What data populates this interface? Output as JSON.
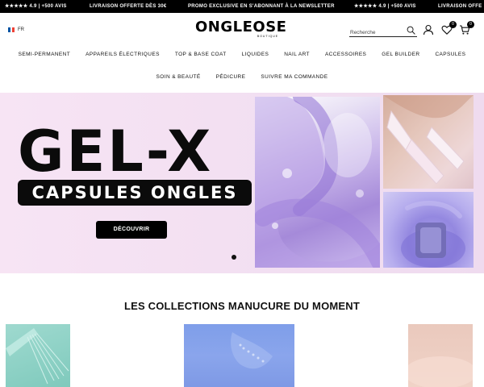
{
  "announcements": [
    "★★★★★ 4.9 | +500 AVIS",
    "LIVRAISON OFFERTE DÈS 30€",
    "PROMO EXCLUSIVE EN S'ABONNANT À LA NEWSLETTER",
    "★★★★★ 4.9 | +500 AVIS",
    "LIVRAISON OFFE"
  ],
  "header": {
    "language_code": "FR",
    "flag_colors": [
      "#0055a4",
      "#ffffff",
      "#ef4135"
    ],
    "logo_main": "ONGLEOSE",
    "logo_sub": "BOUTIQUE",
    "search_placeholder": "Recherche",
    "icons": [
      "search-icon",
      "account-icon",
      "wishlist-icon",
      "cart-icon"
    ],
    "wishlist_count": "0",
    "cart_count": "0"
  },
  "nav": {
    "row1": [
      "SEMI-PERMANENT",
      "APPAREILS ÉLECTRIQUES",
      "TOP & BASE COAT",
      "LIQUIDES",
      "NAIL ART",
      "ACCESSOIRES",
      "GEL BUILDER",
      "CAPSULES"
    ],
    "row2": [
      "SOIN & BEAUTÉ",
      "PÉDICURE",
      "SUIVRE MA COMMANDE"
    ]
  },
  "hero": {
    "title": "GEL-X",
    "subtitle": "CAPSULES ONGLES",
    "button_label": "DÉCOUVRIR",
    "background_color": "#f4e1f3",
    "slide_count": 1
  },
  "collections": {
    "title": "LES COLLECTIONS MANUCURE DU MOMENT",
    "tile_colors": [
      "#8fd2c6",
      "#8aa5ec",
      "#efd1c5"
    ]
  }
}
